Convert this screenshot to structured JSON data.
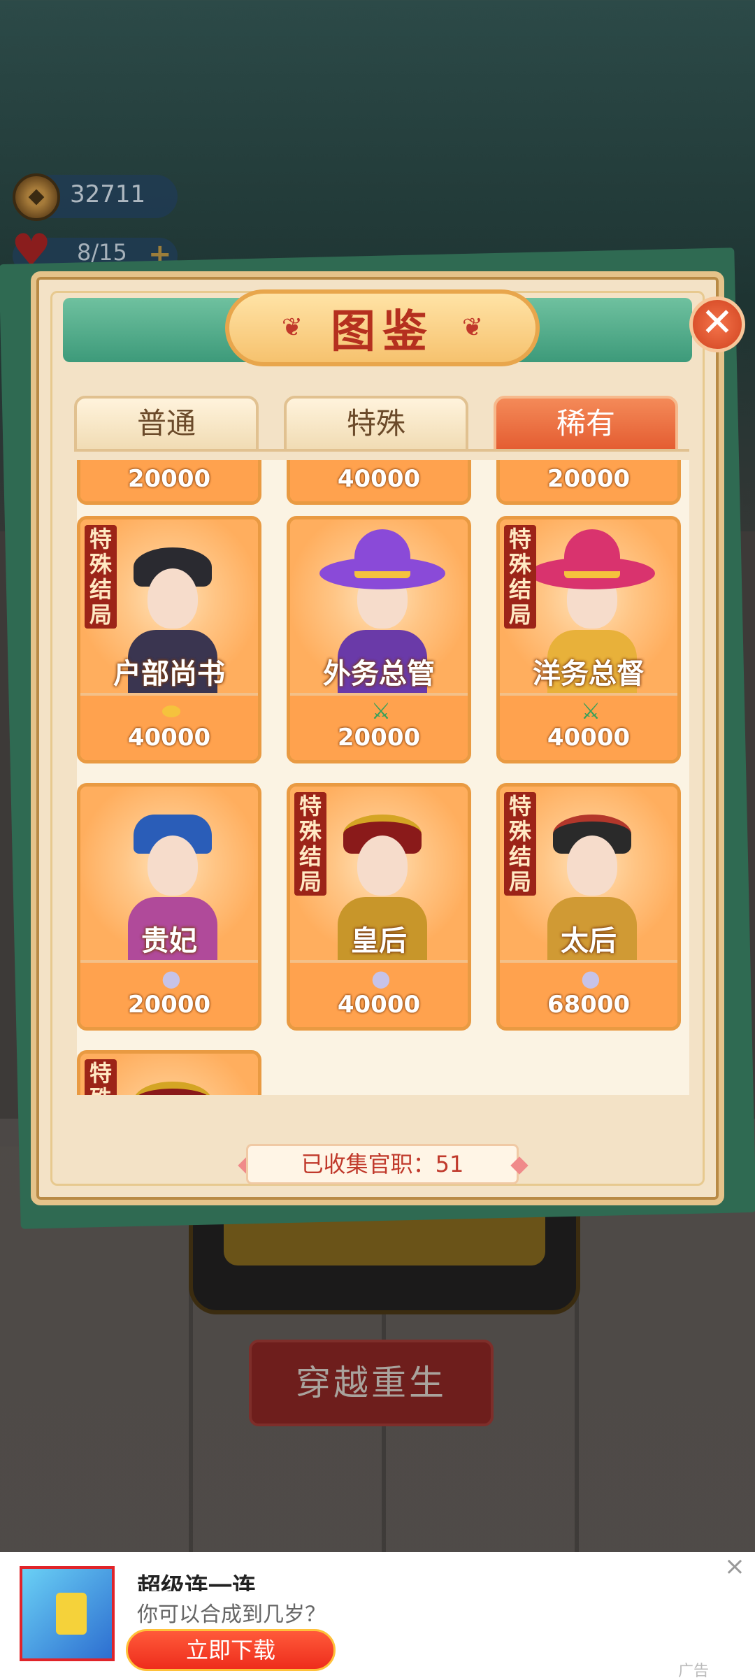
{
  "hud": {
    "coins": "32711",
    "hearts": "8/15",
    "plus": "+"
  },
  "background": {
    "rebirth_button": "穿越重生"
  },
  "modal": {
    "title": "图鉴",
    "close": "✕",
    "tabs": [
      {
        "label": "普通",
        "active": false
      },
      {
        "label": "特殊",
        "active": false
      },
      {
        "label": "稀有",
        "active": true
      }
    ],
    "top_row_costs": [
      "20000",
      "40000",
      "20000"
    ],
    "cards": [
      {
        "name": "户部尚书",
        "cost": "40000",
        "special": true,
        "currency": "gold-ingot-icon"
      },
      {
        "name": "外务总管",
        "cost": "20000",
        "special": false,
        "currency": "sword-icon"
      },
      {
        "name": "洋务总督",
        "cost": "40000",
        "special": true,
        "currency": "sword-icon"
      },
      {
        "name": "贵妃",
        "cost": "20000",
        "special": false,
        "currency": "pearl-icon"
      },
      {
        "name": "皇后",
        "cost": "40000",
        "special": true,
        "currency": "pearl-icon"
      },
      {
        "name": "太后",
        "cost": "68000",
        "special": true,
        "currency": "pearl-icon"
      }
    ],
    "badge_chars": [
      "特",
      "殊",
      "结",
      "局"
    ],
    "partial_badge_chars": [
      "特",
      "殊"
    ],
    "collected": "已收集官职：51"
  },
  "ad": {
    "title": "超级连一连",
    "subtitle": "你可以合成到几岁？",
    "button": "立即下载",
    "close": "×",
    "label": "广告"
  }
}
